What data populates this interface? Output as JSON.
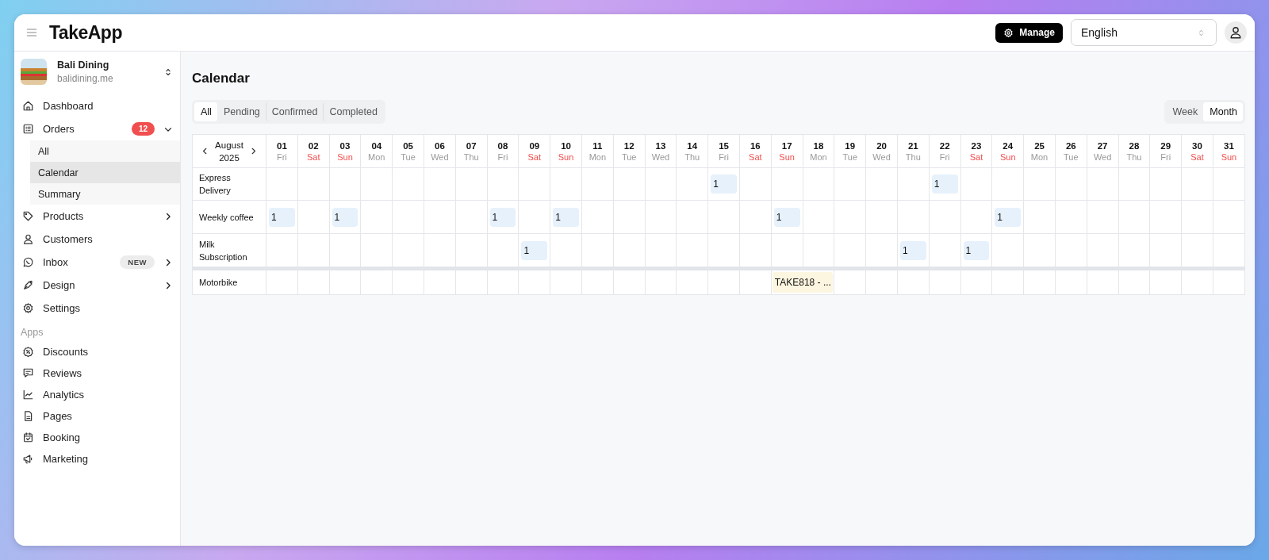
{
  "header": {
    "logo": "TakeApp",
    "manage_button": "Manage",
    "language": "English"
  },
  "sidebar": {
    "store": {
      "name": "Bali Dining",
      "domain": "balidining.me"
    },
    "items": [
      {
        "label": "Dashboard"
      },
      {
        "label": "Orders",
        "badge": {
          "text": "12",
          "kind": "count"
        },
        "expanded": true,
        "children": [
          {
            "label": "All",
            "selected": false
          },
          {
            "label": "Calendar",
            "selected": true
          },
          {
            "label": "Summary",
            "selected": false
          }
        ]
      },
      {
        "label": "Products",
        "expanded": false
      },
      {
        "label": "Customers"
      },
      {
        "label": "Inbox",
        "badge": {
          "text": "NEW",
          "kind": "new"
        },
        "expanded": false
      },
      {
        "label": "Design",
        "expanded": false
      },
      {
        "label": "Settings"
      }
    ],
    "apps_heading": "Apps",
    "apps": [
      {
        "label": "Discounts"
      },
      {
        "label": "Reviews"
      },
      {
        "label": "Analytics"
      },
      {
        "label": "Pages"
      },
      {
        "label": "Booking"
      },
      {
        "label": "Marketing"
      }
    ]
  },
  "page_title": "Calendar",
  "status_tabs": [
    {
      "label": "All",
      "selected": true
    },
    {
      "label": "Pending",
      "selected": false
    },
    {
      "label": "Confirmed",
      "selected": false
    },
    {
      "label": "Completed",
      "selected": false
    }
  ],
  "view_tabs": [
    {
      "label": "Week",
      "selected": false
    },
    {
      "label": "Month",
      "selected": true
    }
  ],
  "calendar": {
    "month": "August",
    "year": "2025",
    "days": [
      {
        "date": "01",
        "weekday": "Fri",
        "weekend": false
      },
      {
        "date": "02",
        "weekday": "Sat",
        "weekend": true
      },
      {
        "date": "03",
        "weekday": "Sun",
        "weekend": true
      },
      {
        "date": "04",
        "weekday": "Mon",
        "weekend": false
      },
      {
        "date": "05",
        "weekday": "Tue",
        "weekend": false
      },
      {
        "date": "06",
        "weekday": "Wed",
        "weekend": false
      },
      {
        "date": "07",
        "weekday": "Thu",
        "weekend": false
      },
      {
        "date": "08",
        "weekday": "Fri",
        "weekend": false
      },
      {
        "date": "09",
        "weekday": "Sat",
        "weekend": true
      },
      {
        "date": "10",
        "weekday": "Sun",
        "weekend": true
      },
      {
        "date": "11",
        "weekday": "Mon",
        "weekend": false
      },
      {
        "date": "12",
        "weekday": "Tue",
        "weekend": false
      },
      {
        "date": "13",
        "weekday": "Wed",
        "weekend": false
      },
      {
        "date": "14",
        "weekday": "Thu",
        "weekend": false
      },
      {
        "date": "15",
        "weekday": "Fri",
        "weekend": false
      },
      {
        "date": "16",
        "weekday": "Sat",
        "weekend": true
      },
      {
        "date": "17",
        "weekday": "Sun",
        "weekend": true
      },
      {
        "date": "18",
        "weekday": "Mon",
        "weekend": false
      },
      {
        "date": "19",
        "weekday": "Tue",
        "weekend": false
      },
      {
        "date": "20",
        "weekday": "Wed",
        "weekend": false
      },
      {
        "date": "21",
        "weekday": "Thu",
        "weekend": false
      },
      {
        "date": "22",
        "weekday": "Fri",
        "weekend": false
      },
      {
        "date": "23",
        "weekday": "Sat",
        "weekend": true
      },
      {
        "date": "24",
        "weekday": "Sun",
        "weekend": true
      },
      {
        "date": "25",
        "weekday": "Mon",
        "weekend": false
      },
      {
        "date": "26",
        "weekday": "Tue",
        "weekend": false
      },
      {
        "date": "27",
        "weekday": "Wed",
        "weekend": false
      },
      {
        "date": "28",
        "weekday": "Thu",
        "weekend": false
      },
      {
        "date": "29",
        "weekday": "Fri",
        "weekend": false
      },
      {
        "date": "30",
        "weekday": "Sat",
        "weekend": true
      },
      {
        "date": "31",
        "weekday": "Sun",
        "weekend": true
      }
    ],
    "sections": [
      {
        "rows": [
          {
            "label": "Express Delivery",
            "cells": [
              null,
              null,
              null,
              null,
              null,
              null,
              null,
              null,
              null,
              null,
              null,
              null,
              null,
              null,
              {
                "text": "1",
                "kind": "count"
              },
              null,
              null,
              null,
              null,
              null,
              null,
              {
                "text": "1",
                "kind": "count"
              },
              null,
              null,
              null,
              null,
              null,
              null,
              null,
              null,
              null
            ]
          },
          {
            "label": "Weekly coffee",
            "cells": [
              {
                "text": "1",
                "kind": "count"
              },
              null,
              {
                "text": "1",
                "kind": "count"
              },
              null,
              null,
              null,
              null,
              {
                "text": "1",
                "kind": "count"
              },
              null,
              {
                "text": "1",
                "kind": "count"
              },
              null,
              null,
              null,
              null,
              null,
              null,
              {
                "text": "1",
                "kind": "count"
              },
              null,
              null,
              null,
              null,
              null,
              null,
              {
                "text": "1",
                "kind": "count"
              },
              null,
              null,
              null,
              null,
              null,
              null,
              null
            ]
          },
          {
            "label": "Milk Subscription",
            "cells": [
              null,
              null,
              null,
              null,
              null,
              null,
              null,
              null,
              {
                "text": "1",
                "kind": "count"
              },
              null,
              null,
              null,
              null,
              null,
              null,
              null,
              null,
              null,
              null,
              null,
              {
                "text": "1",
                "kind": "count"
              },
              null,
              {
                "text": "1",
                "kind": "count"
              },
              null,
              null,
              null,
              null,
              null,
              null,
              null,
              null
            ]
          }
        ]
      },
      {
        "rows": [
          {
            "label": "Motorbike",
            "cells": [
              null,
              null,
              null,
              null,
              null,
              null,
              null,
              null,
              null,
              null,
              null,
              null,
              null,
              null,
              null,
              null,
              {
                "text": "TAKE818 - ...",
                "kind": "booking"
              },
              null,
              null,
              null,
              null,
              null,
              null,
              null,
              null,
              null,
              null,
              null,
              null,
              null,
              null
            ]
          }
        ]
      }
    ]
  }
}
